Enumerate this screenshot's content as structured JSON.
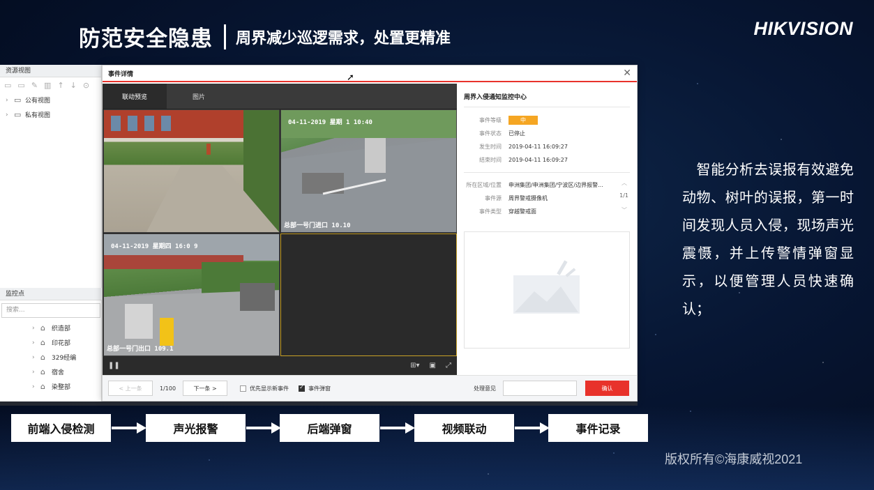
{
  "slide": {
    "title": "防范安全隐患",
    "subtitle": "周界减少巡逻需求，处置更精准",
    "logo": "HIKVISION",
    "description": "　智能分析去误报有效避免动物、树叶的误报，第一时间发现人员入侵，现场声光震慑，并上传警情弹窗显示，以便管理人员快速确认；",
    "copyright": "版权所有©海康威视2021",
    "flow_steps": [
      "前端入侵检测",
      "声光报警",
      "后端弹窗",
      "视频联动",
      "事件记录"
    ]
  },
  "left_panel": {
    "resource_header": "资源视图",
    "tree": [
      {
        "label": "公有视图",
        "icon": "folder-icon"
      },
      {
        "label": "私有视图",
        "icon": "folder-icon"
      }
    ],
    "monitor_header": "监控点",
    "search_placeholder": "搜索...",
    "monitor_items": [
      {
        "label": "织造部",
        "icon": "home-icon"
      },
      {
        "label": "印花部",
        "icon": "home-icon"
      },
      {
        "label": "329经编",
        "icon": "home-icon"
      },
      {
        "label": "宿舍",
        "icon": "home-icon"
      },
      {
        "label": "染整部",
        "icon": "home-icon"
      }
    ]
  },
  "dialog": {
    "title": "事件详情",
    "tabs": [
      "联动预览",
      "图片"
    ],
    "cameras": [
      {
        "osd_top": "",
        "osd_bottom": ""
      },
      {
        "osd_top": "04-11-2019 星期 1 10:40",
        "osd_bottom": "总部一号门进口 10.10"
      },
      {
        "osd_top": "04-11-2019 星期四 16:0 9",
        "osd_bottom": "总部一号门出口 109.1"
      },
      {
        "osd_top": "",
        "osd_bottom": ""
      }
    ],
    "info_title": "周界入侵通知监控中心",
    "fields": [
      {
        "label": "事件等级",
        "value": "中"
      },
      {
        "label": "事件状态",
        "value": "已停止"
      },
      {
        "label": "发生时间",
        "value": "2019-04-11 16:09:27"
      },
      {
        "label": "结束时间",
        "value": "2019-04-11 16:09:27"
      }
    ],
    "fields2": [
      {
        "label": "所在区域/位置",
        "value": "申洲集团/申洲集团/宁波区/边界报警..."
      },
      {
        "label": "事件源",
        "value": "周界警戒摄像机"
      },
      {
        "label": "事件类型",
        "value": "穿越警戒面"
      }
    ],
    "pager": "1/1",
    "footer": {
      "prev": "< 上一条",
      "count": "1/100",
      "next": "下一条 >",
      "opt1": "优先显示新事件",
      "opt2": "事件弹窗",
      "comment_label": "处理意见",
      "confirm": "确认"
    }
  },
  "colors": {
    "accent": "#e8322b",
    "level": "#f5a623"
  }
}
